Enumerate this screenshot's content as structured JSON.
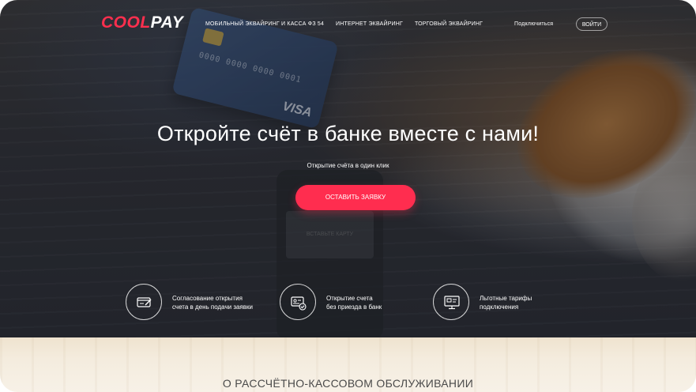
{
  "brand": {
    "part1": "COOL",
    "part2": "PAY"
  },
  "nav": {
    "links": [
      "МОБИЛЬНЫЙ ЭКВАЙРИНГ И КАССА ФЗ 54",
      "ИНТЕРНЕТ ЭКВАЙРИНГ",
      "ТОРГОВЫЙ ЭКВАЙРИНГ"
    ],
    "connect": "Подключиться",
    "login": "ВОЙТИ"
  },
  "hero": {
    "title": "Откройте счёт в банке вместе с нами!",
    "subtitle": "Открытие счёта в один клик",
    "cta": "ОСТАВИТЬ ЗАЯВКУ"
  },
  "photo_text": {
    "card_numbers": "0000 0000 0000 0001",
    "card_brand": "VISA",
    "terminal_screen": "ВСТАВЬТЕ КАРТУ"
  },
  "features": [
    {
      "line1": "Согласование открытия",
      "line2": "счета в день подачи заявки",
      "icon": "card-check-icon"
    },
    {
      "line1": "Открытие счета",
      "line2": "без приезда в банк",
      "icon": "id-card-check-icon"
    },
    {
      "line1": "Льготные тарифы",
      "line2": "подключения",
      "icon": "monitor-icon"
    }
  ],
  "section": {
    "title": "О РАССЧЁТНО-КАССОВОМ ОБСЛУЖИВАНИИ"
  },
  "colors": {
    "accent": "#ff2d4f",
    "text_light": "#ffffff"
  }
}
